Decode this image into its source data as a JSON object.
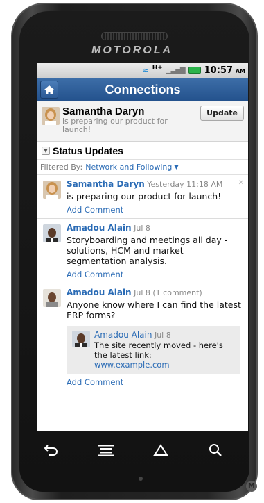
{
  "device": {
    "brand": "MOTOROLA"
  },
  "status_bar": {
    "network": "H+",
    "time": "10:57",
    "ampm": "AM"
  },
  "app_bar": {
    "title": "Connections"
  },
  "profile": {
    "name": "Samantha Daryn",
    "status": "is preparing our product for launch!",
    "update_label": "Update"
  },
  "status_updates": {
    "title": "Status Updates",
    "filter_label": "Filtered By:",
    "filter_value": "Network and Following"
  },
  "feed": [
    {
      "author": "Samantha Daryn",
      "meta": "Yesterday 11:18 AM",
      "text": "is preparing our product for launch!",
      "add_comment": "Add Comment"
    },
    {
      "author": "Amadou Alain",
      "meta": "Jul 8",
      "text": "Storyboarding and meetings all day - solutions, HCM and market segmentation analysis.",
      "add_comment": "Add Comment"
    },
    {
      "author": "Amadou Alain",
      "meta": "Jul 8 (1 comment)",
      "text": "Anyone know where I can find the latest ERP forms?",
      "add_comment": "Add Comment",
      "comment": {
        "author": "Amadou Alain",
        "meta": "Jul 8",
        "text": "The site recently moved - here's the latest link:",
        "link": "www.example.com"
      }
    }
  ],
  "colors": {
    "accent": "#2a6bb5",
    "appbar": "#23518c"
  }
}
